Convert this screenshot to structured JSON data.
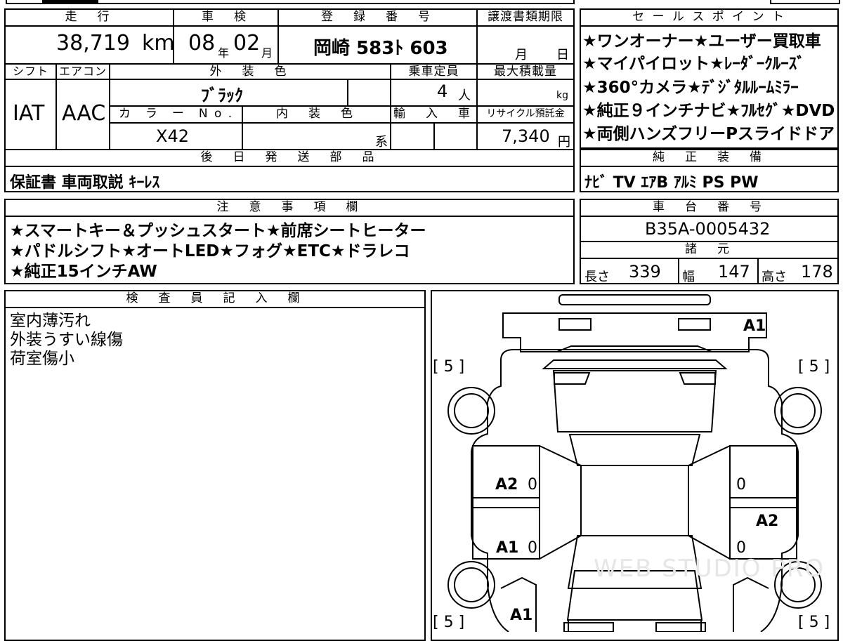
{
  "top": {
    "mileage_header": "走　行",
    "mileage_value": "38,719",
    "mileage_unit": "km",
    "inspection_header": "車　検",
    "inspection_year": "08",
    "inspection_year_unit": "年",
    "inspection_month": "02",
    "inspection_month_unit": "月",
    "registration_header": "登　録　番　号",
    "registration_value": "岡崎 583ﾄ 603",
    "transfer_header": "譲渡書類期限",
    "transfer_month_unit": "月",
    "transfer_day_unit": "日"
  },
  "row2": {
    "shift_header": "シフト",
    "shift_value": "IAT",
    "ac_header": "エアコン",
    "ac_value": "AAC",
    "exterior_header": "外　装　色",
    "exterior_value": "ﾌﾞﾗｯｸ",
    "capacity_header": "乗車定員",
    "capacity_value": "4",
    "capacity_unit": "人",
    "load_header": "最大積載量",
    "load_unit": "kg",
    "color_no_header": "カ　ラ　ー　N o .",
    "color_no_value": "X42",
    "interior_header": "内　装　色",
    "interior_unit": "系",
    "import_header": "輸　入　車",
    "recycle_header": "リサイクル預託金",
    "recycle_value": "7,340",
    "recycle_unit": "円"
  },
  "later_parts": {
    "header": "後　日　発　送　部　品",
    "value": "保証書 車両取説 ｷｰﾚｽ"
  },
  "sales_points": {
    "header": "セ ー ル ス ポ イ ン ト",
    "lines": [
      "★ワンオーナー★ユーザー買取車",
      "★マイパイロット★ﾚｰﾀﾞｰｸﾙｰｽﾞ",
      "★360°カメラ★ﾃﾞｼﾞﾀﾙﾙｰﾑﾐﾗｰ",
      "★純正９インチナビ★ﾌﾙｾｸﾞ★DVD",
      "★両側ハンズフリーPスライドドア"
    ]
  },
  "genuine_equipment": {
    "header": "純　正　装　備",
    "value": "ﾅﾋﾞ TV ｴｱB ｱﾙﾐ PS PW"
  },
  "notes": {
    "header": "注　意　事　項　欄",
    "lines": [
      "★スマートキー＆プッシュスタート★前席シートヒーター",
      "★パドルシフト★オートLED★フォグ★ETC★ドラレコ",
      "★純正15インチAW"
    ]
  },
  "chassis": {
    "header": "車　台　番　号",
    "value": "B35A-0005432"
  },
  "specs": {
    "header": "諸　元",
    "length_label": "長さ",
    "length_value": "339",
    "width_label": "幅",
    "width_value": "147",
    "height_label": "高さ",
    "height_value": "178"
  },
  "inspector": {
    "header": "検　査　員　記　入　欄",
    "lines": [
      "室内薄汚れ",
      "外装うすい線傷",
      "荷室傷小"
    ]
  },
  "diagram": {
    "marks": {
      "rear_top": "A1",
      "left_front_door": "A2",
      "left_rear_door": "A1",
      "front_bottom": "A1",
      "right_rear_door": "A2"
    },
    "tire_label": "[ 5 ]",
    "zero": "0",
    "watermark": "WEB STUDIO PRO"
  }
}
